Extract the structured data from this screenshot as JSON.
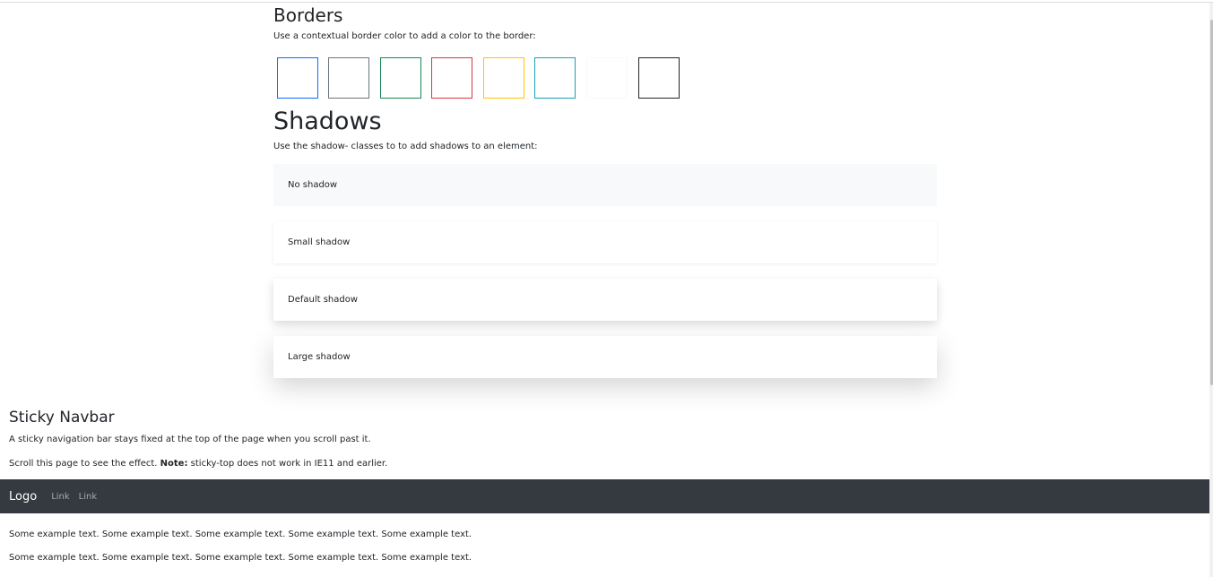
{
  "borders": {
    "title": "Borders",
    "description": "Use a contextual border color to add a color to the border:",
    "boxes": [
      {
        "name": "primary",
        "color": "#0d6efd"
      },
      {
        "name": "secondary",
        "color": "#6c757d"
      },
      {
        "name": "success",
        "color": "#198754"
      },
      {
        "name": "danger",
        "color": "#dc3545"
      },
      {
        "name": "warning",
        "color": "#ffc107"
      },
      {
        "name": "info",
        "color": "#17a2b8"
      },
      {
        "name": "light",
        "color": "#f8f9fa"
      },
      {
        "name": "dark",
        "color": "#212529"
      }
    ]
  },
  "shadows": {
    "title": "Shadows",
    "description": "Use the shadow- classes to to add shadows to an element:",
    "items": [
      {
        "label": "No shadow"
      },
      {
        "label": "Small shadow"
      },
      {
        "label": "Default shadow"
      },
      {
        "label": "Large shadow"
      }
    ]
  },
  "sticky": {
    "title": "Sticky Navbar",
    "description": "A sticky navigation bar stays fixed at the top of the page when you scroll past it.",
    "note_prefix": "Scroll this page to see the effect.",
    "note_bold": "Note:",
    "note_suffix": "sticky-top does not work in IE11 and earlier."
  },
  "navbar": {
    "brand": "Logo",
    "links": [
      "Link",
      "Link"
    ],
    "background": "#343a40"
  },
  "content": {
    "paragraphs": [
      "Some example text. Some example text. Some example text. Some example text. Some example text.",
      "Some example text. Some example text. Some example text. Some example text. Some example text."
    ]
  }
}
